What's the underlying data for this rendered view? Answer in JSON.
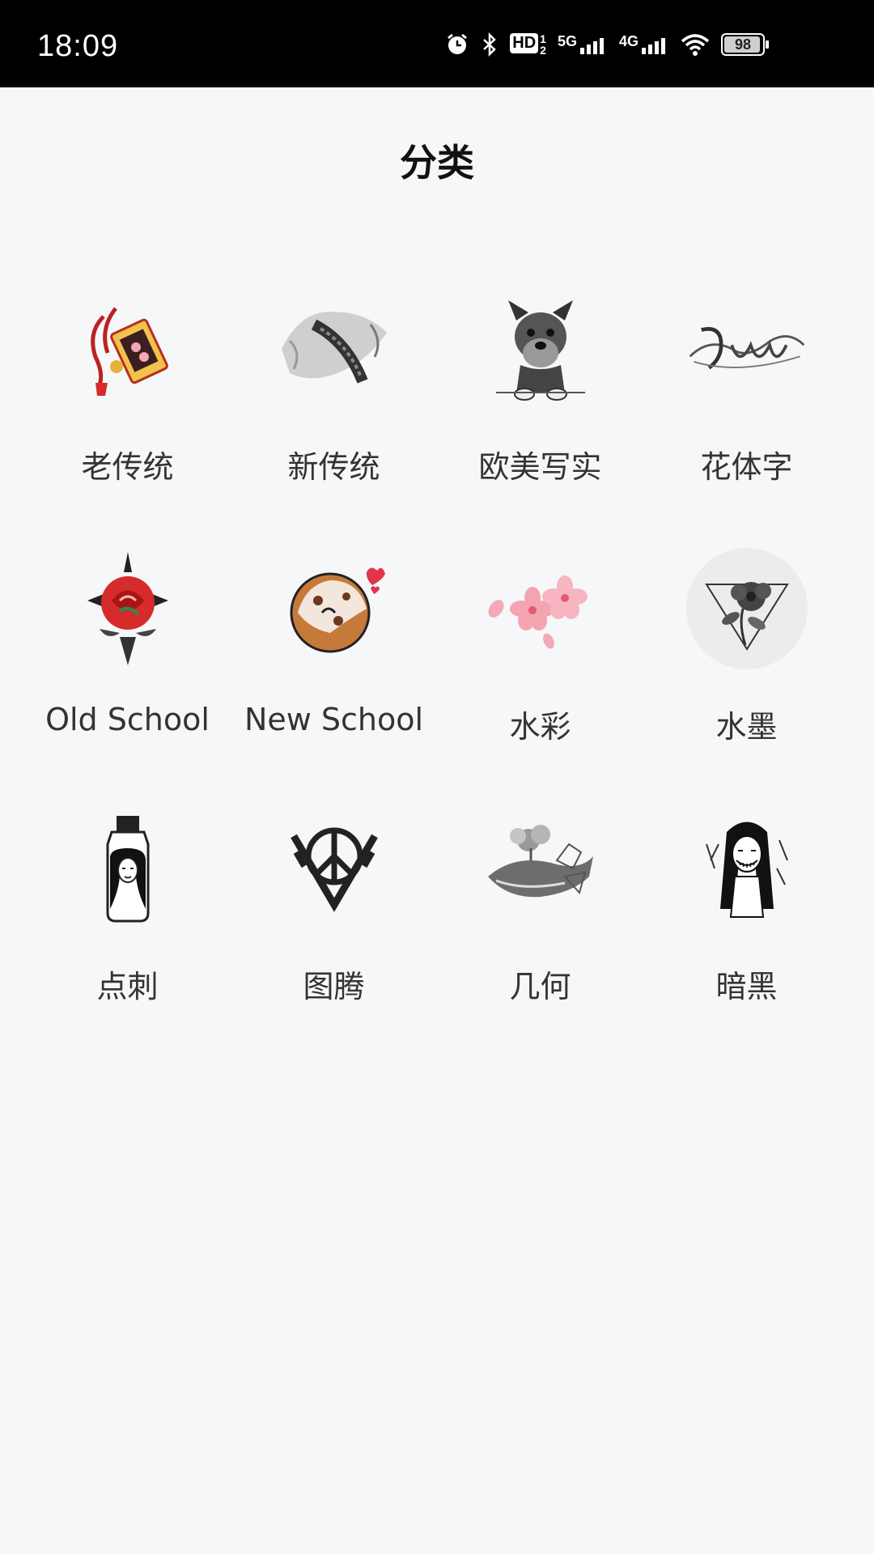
{
  "status": {
    "time": "18:09",
    "hd": "HD",
    "hd_sub_top": "1",
    "hd_sub_bottom": "2",
    "net1": "5G",
    "net2": "4G",
    "battery": "98"
  },
  "header": {
    "title": "分类"
  },
  "categories": [
    {
      "label": "老传统",
      "icon": "tattoo-omamori-icon"
    },
    {
      "label": "新传统",
      "icon": "tattoo-koi-icon"
    },
    {
      "label": "欧美写实",
      "icon": "tattoo-dog-icon"
    },
    {
      "label": "花体字",
      "icon": "tattoo-lettering-icon"
    },
    {
      "label": "Old School",
      "icon": "tattoo-rose-icon"
    },
    {
      "label": "New School",
      "icon": "tattoo-donut-icon"
    },
    {
      "label": "水彩",
      "icon": "tattoo-blossom-icon"
    },
    {
      "label": "水墨",
      "icon": "tattoo-ink-flower-icon"
    },
    {
      "label": "点刺",
      "icon": "tattoo-bottle-girl-icon"
    },
    {
      "label": "图腾",
      "icon": "tattoo-peace-guns-icon"
    },
    {
      "label": "几何",
      "icon": "tattoo-whale-icon"
    },
    {
      "label": "暗黑",
      "icon": "tattoo-dark-girl-icon"
    }
  ]
}
